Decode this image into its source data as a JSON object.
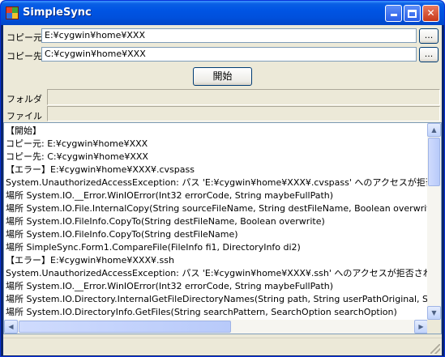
{
  "window": {
    "title": "SimpleSync"
  },
  "source": {
    "label": "コピー元",
    "value": "E:¥cygwin¥home¥XXX",
    "browse_label": "..."
  },
  "dest": {
    "label": "コピー先",
    "value": "C:¥cygwin¥home¥XXX",
    "browse_label": "..."
  },
  "start_button": {
    "label": "開始"
  },
  "progress": {
    "folder_label": "フォルダ",
    "folder_value": "",
    "file_label": "ファイル",
    "file_value": ""
  },
  "log": {
    "lines": [
      "【開始】",
      "コピー元: E:¥cygwin¥home¥XXX",
      "コピー先: C:¥cygwin¥home¥XXX",
      "【エラー】E:¥cygwin¥home¥XXX¥.cvspass",
      "System.UnauthorizedAccessException: パス 'E:¥cygwin¥home¥XXX¥.cvspass' へのアクセスが拒否されまし",
      "   場所 System.IO.__Error.WinIOError(Int32 errorCode, String maybeFullPath)",
      "   場所 System.IO.File.InternalCopy(String sourceFileName, String destFileName, Boolean overwrite)",
      "   場所 System.IO.FileInfo.CopyTo(String destFileName, Boolean overwrite)",
      "   場所 System.IO.FileInfo.CopyTo(String destFileName)",
      "   場所 SimpleSync.Form1.CompareFile(FileInfo fi1, DirectoryInfo di2)",
      "【エラー】E:¥cygwin¥home¥XXX¥.ssh",
      "System.UnauthorizedAccessException: パス 'E:¥cygwin¥home¥XXX¥.ssh' へのアクセスが拒否されました。",
      "   場所 System.IO.__Error.WinIOError(Int32 errorCode, String maybeFullPath)",
      "   場所 System.IO.Directory.InternalGetFileDirectoryNames(String path, String userPathOriginal, String",
      "   場所 System.IO.DirectoryInfo.GetFiles(String searchPattern, SearchOption searchOption)"
    ]
  },
  "colors": {
    "titlebar": "#0054e3",
    "client_bg": "#ece9d8",
    "border": "#7f9db9"
  },
  "icons": {
    "app": "app-icon",
    "minimize": "minimize-icon",
    "maximize": "maximize-icon",
    "close": "close-icon"
  }
}
